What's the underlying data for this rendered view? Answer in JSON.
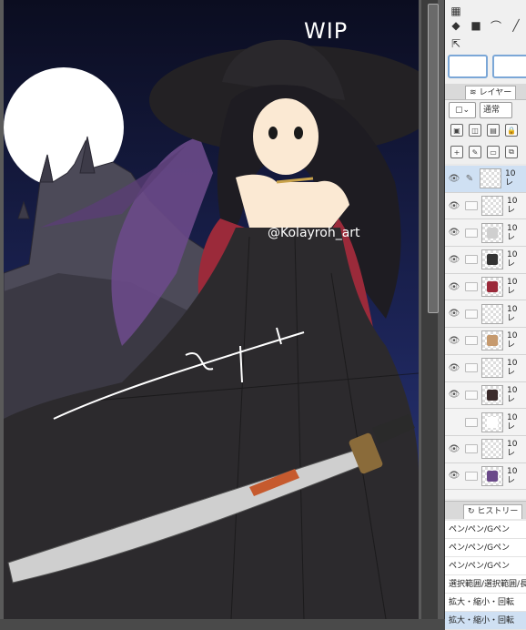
{
  "canvas": {
    "wip_label": "WIP",
    "watermark": "@Kolayroh_art"
  },
  "panel": {
    "layer_tab_label": "レイヤー",
    "blend_mode": "通常",
    "layers": [
      {
        "name": "10",
        "sub": "レ",
        "selected": true,
        "thumb_color": "",
        "visible": true
      },
      {
        "name": "10",
        "sub": "レ",
        "selected": false,
        "thumb_color": "",
        "visible": true
      },
      {
        "name": "10",
        "sub": "レ",
        "selected": false,
        "thumb_color": "#cfcfcf",
        "visible": true
      },
      {
        "name": "10",
        "sub": "レ",
        "selected": false,
        "thumb_color": "#333333",
        "visible": true
      },
      {
        "name": "10",
        "sub": "レ",
        "selected": false,
        "thumb_color": "#9b2a3a",
        "visible": true
      },
      {
        "name": "10",
        "sub": "レ",
        "selected": false,
        "thumb_color": "",
        "visible": true
      },
      {
        "name": "10",
        "sub": "レ",
        "selected": false,
        "thumb_color": "#c69a6e",
        "visible": true
      },
      {
        "name": "10",
        "sub": "レ",
        "selected": false,
        "thumb_color": "",
        "visible": true
      },
      {
        "name": "10",
        "sub": "レ",
        "selected": false,
        "thumb_color": "#3a2b2b",
        "visible": true
      },
      {
        "name": "10",
        "sub": "レ",
        "selected": false,
        "thumb_color": "#ffffff",
        "visible": false
      },
      {
        "name": "10",
        "sub": "レ",
        "selected": false,
        "thumb_color": "",
        "visible": true
      },
      {
        "name": "10",
        "sub": "レ",
        "selected": false,
        "thumb_color": "#6b4a8a",
        "visible": true
      }
    ],
    "history_tab_label": "ヒストリー",
    "history": [
      "ペン/ペン/Gペン",
      "ペン/ペン/Gペン",
      "ペン/ペン/Gペン",
      "選択範囲/選択範囲/長",
      "拡大・縮小・回転",
      "拡大・縮小・回転"
    ]
  },
  "colors": {
    "sky_top": "#0c0f24",
    "sky_bottom": "#2d3a78",
    "moon": "#ffffff",
    "dress": "#2c2a2d",
    "gloves": "#9b2a3a",
    "wing": "#6b4a8a",
    "hat": "#232124"
  }
}
